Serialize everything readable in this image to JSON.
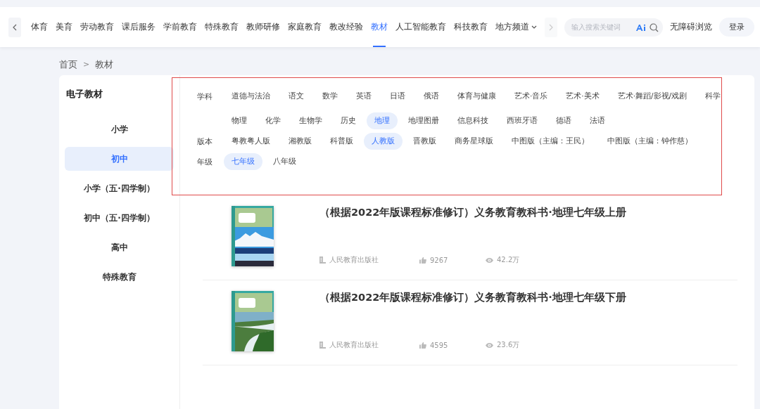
{
  "nav": {
    "items": [
      {
        "label": "体育",
        "selected": false
      },
      {
        "label": "美育",
        "selected": false
      },
      {
        "label": "劳动教育",
        "selected": false
      },
      {
        "label": "课后服务",
        "selected": false
      },
      {
        "label": "学前教育",
        "selected": false
      },
      {
        "label": "特殊教育",
        "selected": false
      },
      {
        "label": "教师研修",
        "selected": false
      },
      {
        "label": "家庭教育",
        "selected": false
      },
      {
        "label": "教改经验",
        "selected": false
      },
      {
        "label": "教材",
        "selected": true
      },
      {
        "label": "人工智能教育",
        "selected": false
      },
      {
        "label": "科技教育",
        "selected": false
      },
      {
        "label": "地方频道",
        "selected": false,
        "kind": "dropdown"
      }
    ],
    "search": {
      "placeholder": "输入搜索关键词"
    },
    "accessibility": "无障碍浏览",
    "login": "登录"
  },
  "breadcrumb": {
    "items": [
      "首页",
      "教材"
    ],
    "separator": ">"
  },
  "sidebar": {
    "title": "电子教材",
    "items": [
      {
        "label": "小学",
        "selected": false
      },
      {
        "label": "初中",
        "selected": true
      },
      {
        "label": "小学（五·四学制）",
        "selected": false
      },
      {
        "label": "初中（五·四学制）",
        "selected": false
      },
      {
        "label": "高中",
        "selected": false
      },
      {
        "label": "特殊教育",
        "selected": false
      }
    ]
  },
  "filters": [
    {
      "label": "学科",
      "options": [
        {
          "text": "道德与法治",
          "selected": false
        },
        {
          "text": "语文",
          "selected": false
        },
        {
          "text": "数学",
          "selected": false
        },
        {
          "text": "英语",
          "selected": false
        },
        {
          "text": "日语",
          "selected": false
        },
        {
          "text": "俄语",
          "selected": false
        },
        {
          "text": "体育与健康",
          "selected": false
        },
        {
          "text": "艺术·音乐",
          "selected": false
        },
        {
          "text": "艺术·美术",
          "selected": false
        },
        {
          "text": "艺术·舞蹈/影视/戏剧",
          "selected": false
        },
        {
          "text": "科学",
          "selected": false
        },
        {
          "text": "物理",
          "selected": false
        },
        {
          "text": "化学",
          "selected": false
        },
        {
          "text": "生物学",
          "selected": false
        },
        {
          "text": "历史",
          "selected": false
        },
        {
          "text": "地理",
          "selected": true
        },
        {
          "text": "地理图册",
          "selected": false
        },
        {
          "text": "信息科技",
          "selected": false
        },
        {
          "text": "西班牙语",
          "selected": false
        },
        {
          "text": "德语",
          "selected": false
        },
        {
          "text": "法语",
          "selected": false
        }
      ]
    },
    {
      "label": "版本",
      "options": [
        {
          "text": "粤教粤人版",
          "selected": false
        },
        {
          "text": "湘教版",
          "selected": false
        },
        {
          "text": "科普版",
          "selected": false
        },
        {
          "text": "人教版",
          "selected": true
        },
        {
          "text": "晋教版",
          "selected": false
        },
        {
          "text": "商务星球版",
          "selected": false
        },
        {
          "text": "中图版（主编：王民）",
          "selected": false
        },
        {
          "text": "中图版（主编：钟作慈）",
          "selected": false
        }
      ]
    },
    {
      "label": "年级",
      "options": [
        {
          "text": "七年级",
          "selected": true
        },
        {
          "text": "八年级",
          "selected": false
        }
      ]
    }
  ],
  "books": [
    {
      "title": "（根据2022年版课程标准修订）义务教育教科书·地理七年级上册",
      "publisher": "人民教育出版社",
      "likes": "9267",
      "views": "42.2万"
    },
    {
      "title": "（根据2022年版课程标准修订）义务教育教科书·地理七年级下册",
      "publisher": "人民教育出版社",
      "likes": "4595",
      "views": "23.6万"
    }
  ]
}
